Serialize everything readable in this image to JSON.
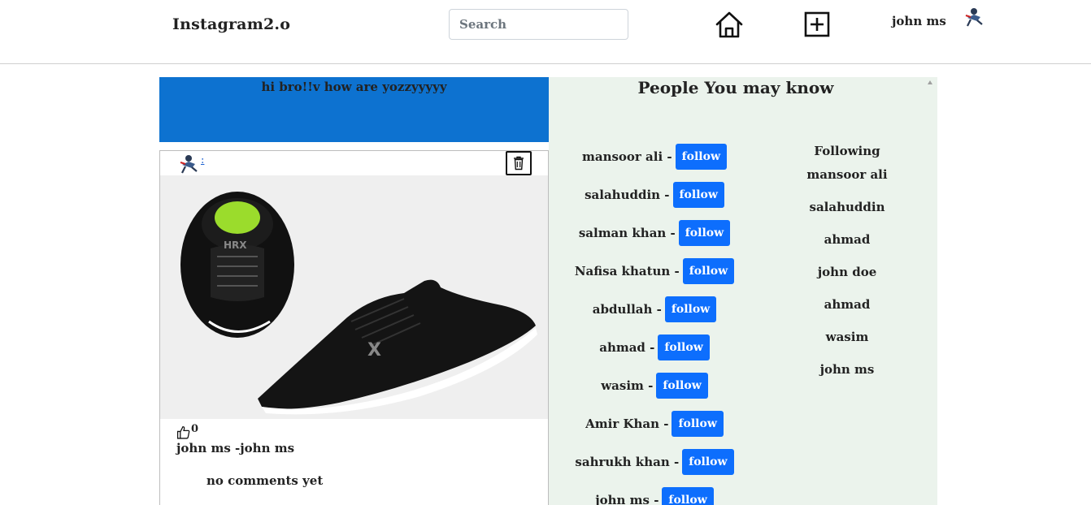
{
  "navbar": {
    "brand": "Instagram2.o",
    "search_placeholder": "Search",
    "home_icon": "home-icon",
    "add_icon": "plus-square-icon",
    "username": "john ms",
    "avatar_icon": "avatar-icon"
  },
  "status": {
    "text": "hi bro!!v how are yozzyyyyy",
    "color": "#0d72d0"
  },
  "post": {
    "author_link": ":",
    "delete_icon": "trash-icon",
    "image_alt": "black sneakers photo",
    "like_icon": "thumbs-up-icon",
    "likes": "0",
    "caption": "john ms -john ms",
    "comments_empty": "no comments yet"
  },
  "suggestions": {
    "title": "People You may know",
    "follow_label": "follow",
    "accent": "#0d6efd",
    "panel_bg": "#ebf3ec",
    "people": [
      "mansoor ali -",
      "salahuddin -",
      "salman khan -",
      "Nafisa khatun -",
      "abdullah -",
      "ahmad -",
      "wasim -",
      "Amir Khan -",
      "sahrukh khan -",
      "john ms -"
    ]
  },
  "following": {
    "heading": "Following",
    "names": [
      "mansoor ali",
      "salahuddin",
      "ahmad",
      "john doe",
      "ahmad",
      "wasim",
      "john ms"
    ]
  }
}
